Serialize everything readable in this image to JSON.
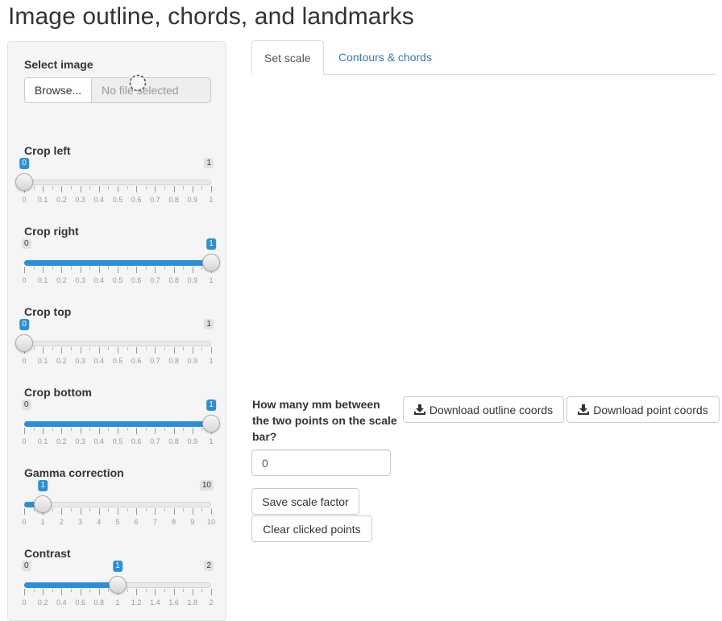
{
  "app": {
    "title": "Image outline, chords, and landmarks"
  },
  "sidebar": {
    "select_image_label": "Select image",
    "browse_label": "Browse...",
    "file_placeholder": "No file selected",
    "sliders": [
      {
        "label": "Crop left",
        "min": 0,
        "max": 1,
        "value": 0,
        "min_label": "0",
        "max_label": "1",
        "value_label": "0",
        "ticks": [
          "0",
          "0.1",
          "0.2",
          "0.3",
          "0.4",
          "0.5",
          "0.6",
          "0.7",
          "0.8",
          "0.9",
          "1"
        ]
      },
      {
        "label": "Crop right",
        "min": 0,
        "max": 1,
        "value": 1,
        "min_label": "0",
        "max_label": "1",
        "value_label": "1",
        "ticks": [
          "0",
          "0.1",
          "0.2",
          "0.3",
          "0.4",
          "0.5",
          "0.6",
          "0.7",
          "0.8",
          "0.9",
          "1"
        ]
      },
      {
        "label": "Crop top",
        "min": 0,
        "max": 1,
        "value": 0,
        "min_label": "0",
        "max_label": "1",
        "value_label": "0",
        "ticks": [
          "0",
          "0.1",
          "0.2",
          "0.3",
          "0.4",
          "0.5",
          "0.6",
          "0.7",
          "0.8",
          "0.9",
          "1"
        ]
      },
      {
        "label": "Crop bottom",
        "min": 0,
        "max": 1,
        "value": 1,
        "min_label": "0",
        "max_label": "1",
        "value_label": "1",
        "ticks": [
          "0",
          "0.1",
          "0.2",
          "0.3",
          "0.4",
          "0.5",
          "0.6",
          "0.7",
          "0.8",
          "0.9",
          "1"
        ]
      },
      {
        "label": "Gamma correction",
        "min": 0,
        "max": 10,
        "value": 1,
        "min_label": "0",
        "max_label": "10",
        "value_label": "1",
        "ticks": [
          "0",
          "1",
          "2",
          "3",
          "4",
          "5",
          "6",
          "7",
          "8",
          "9",
          "10"
        ]
      },
      {
        "label": "Contrast",
        "min": 0,
        "max": 2,
        "value": 1,
        "min_label": "0",
        "max_label": "2",
        "value_label": "1",
        "ticks": [
          "0",
          "0.2",
          "0.4",
          "0.6",
          "0.8",
          "1",
          "1.2",
          "1.4",
          "1.6",
          "1.8",
          "2"
        ]
      }
    ]
  },
  "tabs": [
    {
      "label": "Set scale",
      "active": true
    },
    {
      "label": "Contours & chords",
      "active": false
    }
  ],
  "scale": {
    "mm_label": "How many mm between the two points on the scale bar?",
    "mm_value": "0",
    "save_label": "Save scale factor",
    "clear_label": "Clear clicked points"
  },
  "downloads": {
    "outline_label": "Download outline coords",
    "point_label": "Download point coords"
  },
  "colors": {
    "accent": "#2a8fd6",
    "link": "#337ab7"
  },
  "icons": {
    "download": "download-icon",
    "busy": "busy-spinner-icon"
  }
}
